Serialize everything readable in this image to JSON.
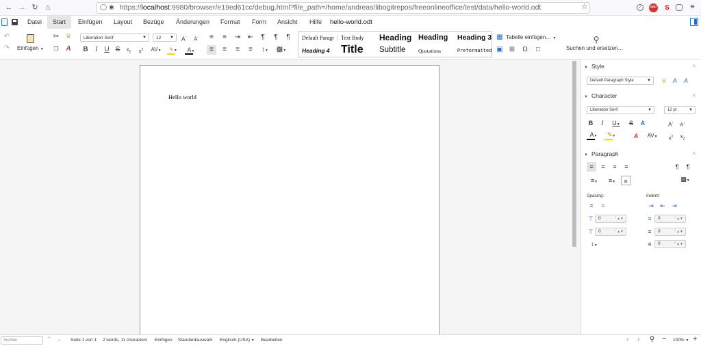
{
  "browser": {
    "url_prefix": "https://",
    "url_host": "localhost",
    "url_rest": ":9980/browser/e19ed61cc/debug.html?file_path=/home/andreas/libogitrepos/freeonlineoffice/test/data/hello-world.odt",
    "ext_adblock": "ABP",
    "ext_s": "S"
  },
  "menu": {
    "items": [
      "Datei",
      "Start",
      "Einfügen",
      "Layout",
      "Bezüge",
      "Änderungen",
      "Format",
      "Form",
      "Ansicht",
      "Hilfe"
    ],
    "active": "Start",
    "document_title": "hello-world.odt"
  },
  "toolbar": {
    "paste_label": "Einfügen",
    "font_name": "Liberation Serif",
    "font_size": "12",
    "styles": {
      "default": "Default Paragr",
      "text_body": "Text Body",
      "heading": "Heading",
      "heading2": "Heading",
      "heading3": "Heading 3",
      "heading4": "Heading 4",
      "title": "Title",
      "subtitle": "Subtitle",
      "quotations": "Quotations",
      "preformatted": "Preformatted"
    },
    "insert_table": "Tabelle einfügen…",
    "search_replace": "Suchen und ersetzen…"
  },
  "document": {
    "text": "Hello world"
  },
  "sidebar": {
    "style_header": "Style",
    "paragraph_style": "Default Paragraph Style",
    "character_header": "Character",
    "char_font": "Liberation Serif",
    "char_size": "12 pt",
    "paragraph_header": "Paragraph",
    "spacing_label": "Spacing:",
    "indent_label": "Indent:",
    "spacing_above": "0",
    "spacing_below": "0",
    "indent_before": "0",
    "indent_after": "0",
    "indent_first": "0",
    "spin_unit": "\""
  },
  "status": {
    "search_placeholder": "Suchen",
    "page": "Seite 1 von 1",
    "words": "2 words, 11 characters",
    "mode": "Einfügen",
    "selection": "Standardauswahl",
    "language": "Englisch (USA)",
    "edit": "Bearbeiten",
    "zoom": "100%"
  },
  "colors": {
    "accent": "#1e6fd9",
    "font_color_bar": "#000000",
    "highlight_bar": "#ffd400",
    "adblock_red": "#d8322e"
  }
}
